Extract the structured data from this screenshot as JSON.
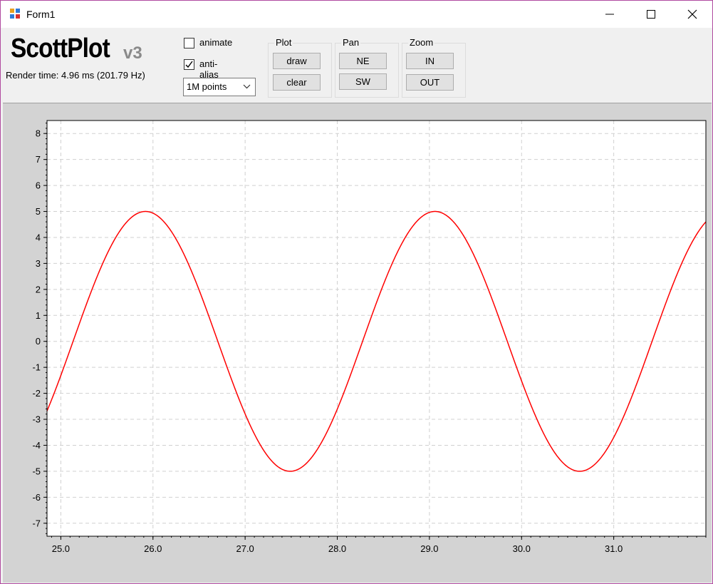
{
  "window": {
    "title": "Form1"
  },
  "logo": {
    "main": "ScottPlot",
    "version": "v3"
  },
  "status": {
    "render_time": "Render time: 4.96 ms (201.79 Hz)"
  },
  "options": {
    "animate": {
      "label": "animate",
      "checked": false
    },
    "anti_alias": {
      "label": "anti-alias",
      "checked": true
    },
    "points_select": {
      "value": "1M points"
    }
  },
  "groups": {
    "plot": {
      "title": "Plot",
      "draw": "draw",
      "clear": "clear"
    },
    "pan": {
      "title": "Pan",
      "ne": "NE",
      "sw": "SW"
    },
    "zoom": {
      "title": "Zoom",
      "in": "IN",
      "out": "OUT"
    }
  },
  "colors": {
    "series": "#ff0000",
    "grid": "#d0d0d0",
    "plot_bg": "#ffffff",
    "panel_bg": "#d3d3d3"
  },
  "chart_data": {
    "type": "line",
    "title": "",
    "xlabel": "",
    "ylabel": "",
    "xlim": [
      24.85,
      32.0
    ],
    "ylim": [
      -7.5,
      8.5
    ],
    "x_ticks": [
      "25.0",
      "26.0",
      "27.0",
      "28.0",
      "29.0",
      "30.0",
      "31.0"
    ],
    "y_ticks": [
      "8",
      "7",
      "6",
      "5",
      "4",
      "3",
      "2",
      "1",
      "0",
      "-1",
      "-2",
      "-3",
      "-4",
      "-5",
      "-6",
      "-7"
    ],
    "grid": true,
    "legend": "none",
    "series": [
      {
        "function": "5*sin(2*x)",
        "amplitude": 5,
        "frequency": 2,
        "x_range": [
          24.85,
          32.0
        ]
      }
    ]
  }
}
